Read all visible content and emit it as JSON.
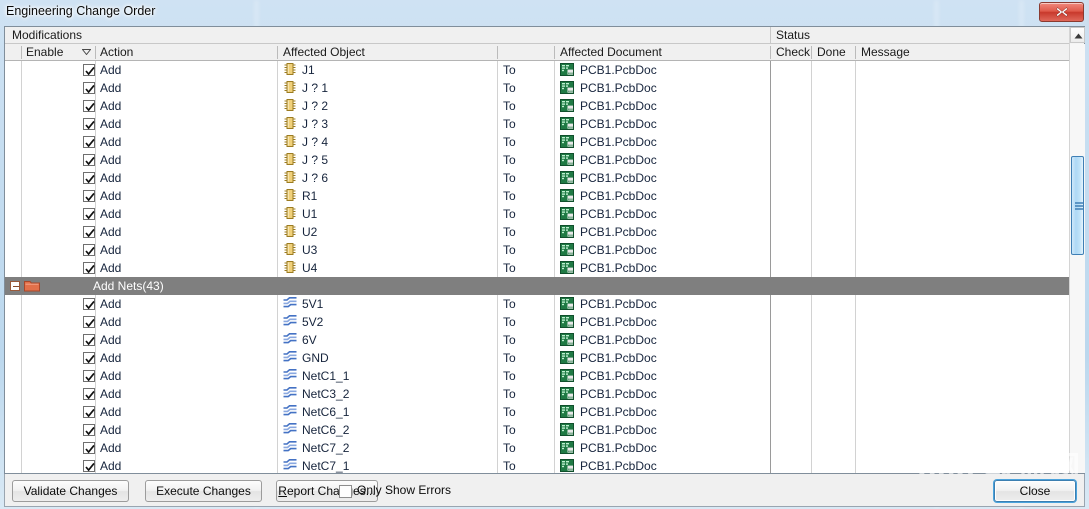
{
  "window": {
    "title": "Engineering Change Order",
    "close_icon": "window-close-icon"
  },
  "groups_band": {
    "modifications": "Modifications",
    "status": "Status"
  },
  "columns": [
    {
      "key": "enable",
      "label": "Enable",
      "sorted": true
    },
    {
      "key": "action",
      "label": "Action",
      "sorted": false
    },
    {
      "key": "object",
      "label": "Affected Object",
      "sorted": false
    },
    {
      "key": "to",
      "label": "",
      "sorted": false
    },
    {
      "key": "document",
      "label": "Affected Document",
      "sorted": false
    },
    {
      "key": "check",
      "label": "Check",
      "sorted": false
    },
    {
      "key": "done",
      "label": "Done",
      "sorted": false
    },
    {
      "key": "message",
      "label": "Message",
      "sorted": false
    }
  ],
  "rows": [
    {
      "type": "item",
      "enabled": true,
      "action": "Add",
      "icon": "component-icon",
      "object": "J1",
      "to": "To",
      "doc_icon": "pcb-document-icon",
      "document": "PCB1.PcbDoc",
      "check": "",
      "done": "",
      "message": ""
    },
    {
      "type": "item",
      "enabled": true,
      "action": "Add",
      "icon": "component-icon",
      "object": "J ? 1",
      "to": "To",
      "doc_icon": "pcb-document-icon",
      "document": "PCB1.PcbDoc",
      "check": "",
      "done": "",
      "message": ""
    },
    {
      "type": "item",
      "enabled": true,
      "action": "Add",
      "icon": "component-icon",
      "object": "J ? 2",
      "to": "To",
      "doc_icon": "pcb-document-icon",
      "document": "PCB1.PcbDoc",
      "check": "",
      "done": "",
      "message": ""
    },
    {
      "type": "item",
      "enabled": true,
      "action": "Add",
      "icon": "component-icon",
      "object": "J ? 3",
      "to": "To",
      "doc_icon": "pcb-document-icon",
      "document": "PCB1.PcbDoc",
      "check": "",
      "done": "",
      "message": ""
    },
    {
      "type": "item",
      "enabled": true,
      "action": "Add",
      "icon": "component-icon",
      "object": "J ? 4",
      "to": "To",
      "doc_icon": "pcb-document-icon",
      "document": "PCB1.PcbDoc",
      "check": "",
      "done": "",
      "message": ""
    },
    {
      "type": "item",
      "enabled": true,
      "action": "Add",
      "icon": "component-icon",
      "object": "J ? 5",
      "to": "To",
      "doc_icon": "pcb-document-icon",
      "document": "PCB1.PcbDoc",
      "check": "",
      "done": "",
      "message": ""
    },
    {
      "type": "item",
      "enabled": true,
      "action": "Add",
      "icon": "component-icon",
      "object": "J ? 6",
      "to": "To",
      "doc_icon": "pcb-document-icon",
      "document": "PCB1.PcbDoc",
      "check": "",
      "done": "",
      "message": ""
    },
    {
      "type": "item",
      "enabled": true,
      "action": "Add",
      "icon": "component-icon",
      "object": "R1",
      "to": "To",
      "doc_icon": "pcb-document-icon",
      "document": "PCB1.PcbDoc",
      "check": "",
      "done": "",
      "message": ""
    },
    {
      "type": "item",
      "enabled": true,
      "action": "Add",
      "icon": "component-icon",
      "object": "U1",
      "to": "To",
      "doc_icon": "pcb-document-icon",
      "document": "PCB1.PcbDoc",
      "check": "",
      "done": "",
      "message": ""
    },
    {
      "type": "item",
      "enabled": true,
      "action": "Add",
      "icon": "component-icon",
      "object": "U2",
      "to": "To",
      "doc_icon": "pcb-document-icon",
      "document": "PCB1.PcbDoc",
      "check": "",
      "done": "",
      "message": ""
    },
    {
      "type": "item",
      "enabled": true,
      "action": "Add",
      "icon": "component-icon",
      "object": "U3",
      "to": "To",
      "doc_icon": "pcb-document-icon",
      "document": "PCB1.PcbDoc",
      "check": "",
      "done": "",
      "message": ""
    },
    {
      "type": "item",
      "enabled": true,
      "action": "Add",
      "icon": "component-icon",
      "object": "U4",
      "to": "To",
      "doc_icon": "pcb-document-icon",
      "document": "PCB1.PcbDoc",
      "check": "",
      "done": "",
      "message": ""
    },
    {
      "type": "group",
      "label": "Add Nets(43)",
      "icon": "folder-icon",
      "expanded": true
    },
    {
      "type": "item",
      "enabled": true,
      "action": "Add",
      "icon": "net-icon",
      "object": "5V1",
      "to": "To",
      "doc_icon": "pcb-document-icon",
      "document": "PCB1.PcbDoc",
      "check": "",
      "done": "",
      "message": ""
    },
    {
      "type": "item",
      "enabled": true,
      "action": "Add",
      "icon": "net-icon",
      "object": "5V2",
      "to": "To",
      "doc_icon": "pcb-document-icon",
      "document": "PCB1.PcbDoc",
      "check": "",
      "done": "",
      "message": ""
    },
    {
      "type": "item",
      "enabled": true,
      "action": "Add",
      "icon": "net-icon",
      "object": "6V",
      "to": "To",
      "doc_icon": "pcb-document-icon",
      "document": "PCB1.PcbDoc",
      "check": "",
      "done": "",
      "message": ""
    },
    {
      "type": "item",
      "enabled": true,
      "action": "Add",
      "icon": "net-icon",
      "object": "GND",
      "to": "To",
      "doc_icon": "pcb-document-icon",
      "document": "PCB1.PcbDoc",
      "check": "",
      "done": "",
      "message": ""
    },
    {
      "type": "item",
      "enabled": true,
      "action": "Add",
      "icon": "net-icon",
      "object": "NetC1_1",
      "to": "To",
      "doc_icon": "pcb-document-icon",
      "document": "PCB1.PcbDoc",
      "check": "",
      "done": "",
      "message": ""
    },
    {
      "type": "item",
      "enabled": true,
      "action": "Add",
      "icon": "net-icon",
      "object": "NetC3_2",
      "to": "To",
      "doc_icon": "pcb-document-icon",
      "document": "PCB1.PcbDoc",
      "check": "",
      "done": "",
      "message": ""
    },
    {
      "type": "item",
      "enabled": true,
      "action": "Add",
      "icon": "net-icon",
      "object": "NetC6_1",
      "to": "To",
      "doc_icon": "pcb-document-icon",
      "document": "PCB1.PcbDoc",
      "check": "",
      "done": "",
      "message": ""
    },
    {
      "type": "item",
      "enabled": true,
      "action": "Add",
      "icon": "net-icon",
      "object": "NetC6_2",
      "to": "To",
      "doc_icon": "pcb-document-icon",
      "document": "PCB1.PcbDoc",
      "check": "",
      "done": "",
      "message": ""
    },
    {
      "type": "item",
      "enabled": true,
      "action": "Add",
      "icon": "net-icon",
      "object": "NetC7_2",
      "to": "To",
      "doc_icon": "pcb-document-icon",
      "document": "PCB1.PcbDoc",
      "check": "",
      "done": "",
      "message": ""
    },
    {
      "type": "item",
      "enabled": true,
      "action": "Add",
      "icon": "net-icon",
      "object": "NetC7_1",
      "to": "To",
      "doc_icon": "pcb-document-icon",
      "document": "PCB1.PcbDoc",
      "check": "",
      "done": "",
      "message": ""
    }
  ],
  "scrollbar": {
    "up_icon": "scroll-up-icon",
    "thumb_top_pct": 26,
    "thumb_height_pct": 23
  },
  "footer": {
    "validate_label": "Validate Changes",
    "execute_label": "Execute Changes",
    "report_label_pre": "R",
    "report_label_post": "eport Changes...",
    "only_show_errors_label": "Only Show Errors",
    "only_show_errors_checked": false,
    "close_label": "Close"
  },
  "watermark": {
    "line1": "pcb 联盟网",
    "line2": "www.pcbbar.com"
  },
  "colors": {
    "accent": "#3c7fb1",
    "group_row": "#7f7f7f",
    "component_icon": "#d8b55a",
    "net_icon": "#4472c4",
    "doc_icon": "#1f7a44",
    "folder_icon": "#e2704a",
    "close_btn": "#c8392c"
  }
}
